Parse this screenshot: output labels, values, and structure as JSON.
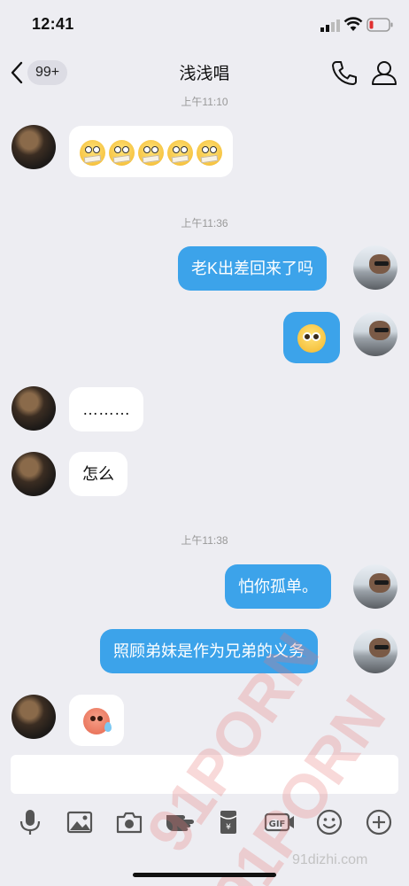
{
  "status_bar": {
    "time": "12:41"
  },
  "nav": {
    "back_badge": "99+",
    "title": "浅浅唱"
  },
  "timestamps": [
    "上午11:10",
    "上午11:36",
    "上午11:38"
  ],
  "messages": [
    {
      "side": "in",
      "type": "emoji",
      "emoji": "shocked-taped-mouth",
      "count": 5
    },
    {
      "side": "out",
      "type": "text",
      "text": "老K出差回来了吗"
    },
    {
      "side": "out",
      "type": "emoji",
      "emoji": "pleading-face"
    },
    {
      "side": "in",
      "type": "text",
      "text": "………"
    },
    {
      "side": "in",
      "type": "text",
      "text": "怎么"
    },
    {
      "side": "out",
      "type": "text",
      "text": "怕你孤单。"
    },
    {
      "side": "out",
      "type": "text",
      "text": "照顾弟妹是作为兄弟的义务"
    },
    {
      "side": "in",
      "type": "emoji",
      "emoji": "sweating-red-face"
    }
  ],
  "input": {
    "placeholder": ""
  },
  "toolbar_icons": [
    "microphone-icon",
    "image-icon",
    "camera-icon",
    "hand-icon",
    "red-packet-icon",
    "gif-icon",
    "smiley-icon",
    "plus-icon"
  ],
  "watermark": {
    "text": "91PORN",
    "site": "91dizhi.com"
  },
  "colors": {
    "outgoing_bubble": "#3ca3ea",
    "incoming_bubble": "#ffffff",
    "background": "#ededf2"
  }
}
